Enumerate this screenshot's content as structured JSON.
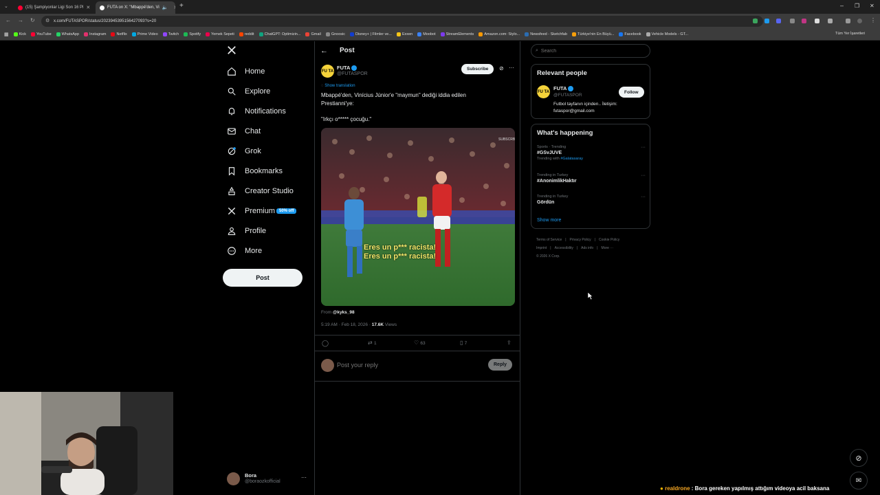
{
  "browser": {
    "tabs": [
      {
        "title": "(15) Şampiyonlar Ligi Son 16 Pl",
        "active": false
      },
      {
        "title": "FUTA on X: \"Mbappé'den, Vi",
        "active": true
      }
    ],
    "url": "x.com/FUTASPOR/status/2023945395156427093?s=20",
    "bookmarks": [
      "Kick",
      "YouTube",
      "WhatsApp",
      "Instagram",
      "Netflix",
      "Prime Video",
      "Twitch",
      "Spotify",
      "Yemek Sepeti",
      "reddit",
      "ChatGPT: Optimizin...",
      "Gmail",
      "Gnoosic",
      "Disney+ | Filmler ve...",
      "Exxen",
      "Moobot",
      "StreamElements",
      "Amazon.com: Stylo...",
      "Newsfeed - Sketchfab",
      "Türkiye'nin En Büyü...",
      "Facebook",
      "Vehicle Models - GT..."
    ],
    "all_bookmarks": "Tüm Yer İşaretleri"
  },
  "nav": {
    "items": [
      {
        "label": "Home",
        "icon": "home-icon"
      },
      {
        "label": "Explore",
        "icon": "search-icon"
      },
      {
        "label": "Notifications",
        "icon": "bell-icon"
      },
      {
        "label": "Chat",
        "icon": "mail-icon"
      },
      {
        "label": "Grok",
        "icon": "grok-icon"
      },
      {
        "label": "Bookmarks",
        "icon": "bookmark-icon"
      },
      {
        "label": "Creator Studio",
        "icon": "creator-studio-icon"
      },
      {
        "label": "Premium",
        "icon": "x-logo-icon"
      },
      {
        "label": "Profile",
        "icon": "person-icon"
      },
      {
        "label": "More",
        "icon": "more-circle-icon"
      }
    ],
    "premium_badge": "50% off",
    "post_button": "Post",
    "account": {
      "name": "Bora",
      "handle": "@boraozkofficial"
    }
  },
  "post": {
    "header": "Post",
    "author": {
      "name": "FUTA",
      "handle": "@FUTASPOR",
      "logo": "FU TA"
    },
    "subscribe": "Subscribe",
    "show_translation": "Show translation",
    "text_line1": "Mbappé'den, Vinícius Júnior'e \"maymun\" dediği iddia edilen",
    "text_line2": "Prestianni'ye:",
    "quote": "\"Irkçı o***** çocuğu.\"",
    "media_caption_1": "Eres un p*** racista!",
    "media_caption_2": "Eres un p*** racista!",
    "from_label": "From",
    "from_handle": "@kyks_98",
    "timestamp": "5:19 AM · Feb 18, 2026 · ",
    "views_count": "17.6K",
    "views_label": " Views",
    "stats": {
      "replies": "",
      "reposts": "1",
      "likes": "63",
      "bookmarks": "7"
    },
    "reply_placeholder": "Post your reply",
    "reply_button": "Reply"
  },
  "sidebar": {
    "search_placeholder": "Search",
    "relevant_title": "Relevant people",
    "person": {
      "name": "FUTA",
      "handle": "@FUTASPOR",
      "bio_line1": "Futbol tayfanın içinden.. İletişim:",
      "bio_line2": "futaspor@gmail.com",
      "follow": "Follow"
    },
    "happening_title": "What's happening",
    "trends": [
      {
        "context": "Sports · Trending",
        "name": "#GSvJUVE",
        "extra_prefix": "Trending with ",
        "extra_link": "#Galatasaray"
      },
      {
        "context": "Trending in Turkey",
        "name": "#AnonimlikHaktır",
        "extra_prefix": "",
        "extra_link": ""
      },
      {
        "context": "Trending in Turkey",
        "name": "Gördün",
        "extra_prefix": "",
        "extra_link": ""
      }
    ],
    "show_more": "Show more",
    "footer": [
      "Terms of Service",
      "Privacy Policy",
      "Cookie Policy",
      "Imprint",
      "Accessibility",
      "Ads info",
      "More ···",
      "© 2026 X Corp."
    ]
  },
  "stream": {
    "chat_user": "realdrone",
    "chat_message": " : Bora gereken yapılmış attığım videoya acil baksana"
  },
  "colors": {
    "accent": "#1d9bf0",
    "bg": "#000000",
    "border": "#2f3336",
    "muted": "#71767b"
  }
}
